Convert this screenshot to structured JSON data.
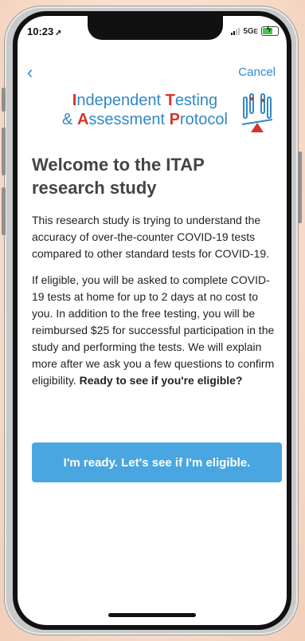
{
  "status_bar": {
    "time": "10:23",
    "network": "5G",
    "network_suffix": "E",
    "battery_color": "#45c84b"
  },
  "nav": {
    "back_icon": "chevron-left",
    "cancel_label": "Cancel",
    "link_color": "#2f8ad6"
  },
  "logo": {
    "line1": {
      "cap1": "I",
      "rest1": "ndependent ",
      "cap2": "T",
      "rest2": "esting"
    },
    "line2": {
      "prefix": "& ",
      "cap1": "A",
      "rest1": "ssessment ",
      "cap2": "P",
      "rest2": "rotocol"
    },
    "text_color": "#2f88c6",
    "accent_color": "#d7332b"
  },
  "welcome": {
    "title": "Welcome to the ITAP research study",
    "para1": "This research study is trying to understand the accuracy of over-the-counter COVID-19 tests compared to other standard tests for COVID-19.",
    "para2_plain": "If eligible, you will be asked to complete COVID-19 tests at home for up to 2 days at no cost to you. In addition to the free testing, you will be reimbursed $25 for successful participation in the study and performing the tests. We will explain more after we ask you a few questions to confirm eligibility. ",
    "para2_bold": "Ready to see if you're eligible?"
  },
  "cta": {
    "label": "I'm ready. Let's see if I'm eligible.",
    "color": "#4aa6e0"
  }
}
